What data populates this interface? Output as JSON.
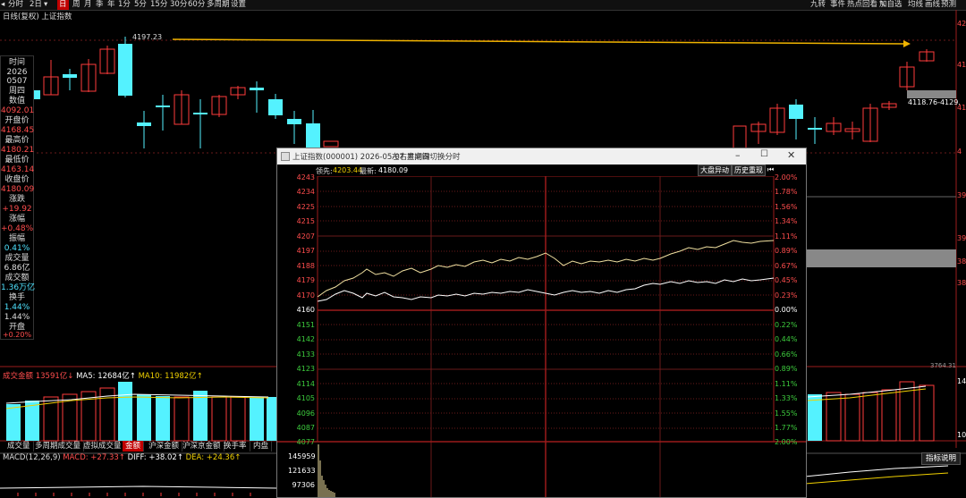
{
  "toolbar": {
    "left_items": [
      "分时",
      "2日",
      "日",
      "周",
      "月",
      "季",
      "年",
      "1分",
      "5分",
      "15分",
      "30分",
      "60分",
      "多周期",
      "设置"
    ],
    "active": "日",
    "right_items": [
      "九转",
      "事件",
      "热点回看",
      "自选",
      "均线",
      "画线",
      "预测"
    ]
  },
  "chart": {
    "subtitle": "日线(复权) 上证指数",
    "high_label": "4197.23",
    "last_range_label": "4118.76-4129.",
    "right_axis": [
      "42",
      "41",
      "41",
      "4",
      "39",
      "39",
      "38",
      "38",
      "3764.31",
      "14",
      "10"
    ]
  },
  "info_panel": [
    {
      "label": "时间",
      "value": "2026",
      "color": "lbl"
    },
    {
      "label": "",
      "value": "0507",
      "color": "lbl"
    },
    {
      "label": "",
      "value": "周四",
      "color": "lbl"
    },
    {
      "label": "数值",
      "value": "4092.01",
      "color": "red"
    },
    {
      "label": "开盘价",
      "value": "4168.45",
      "color": "red"
    },
    {
      "label": "最高价",
      "value": "4180.21",
      "color": "red"
    },
    {
      "label": "最低价",
      "value": "4163.14",
      "color": "red"
    },
    {
      "label": "收盘价",
      "value": "4180.09",
      "color": "red"
    },
    {
      "label": "涨跌",
      "value": "+19.92",
      "color": "red"
    },
    {
      "label": "涨幅",
      "value": "+0.48%",
      "color": "red"
    },
    {
      "label": "振幅",
      "value": "0.41%",
      "color": "cyan"
    },
    {
      "label": "成交量",
      "value": "6.86亿",
      "color": "lbl"
    },
    {
      "label": "成交额",
      "value": "1.36万亿",
      "color": "cyan"
    },
    {
      "label": "换手",
      "value": "1.44%",
      "color": "cyan"
    },
    {
      "label": "开盘涨幅",
      "value": "+0.20%",
      "color": "red"
    }
  ],
  "info_order": [
    "时间",
    "2026",
    "0507",
    "周四",
    "数值",
    "4092.01",
    "开盘价",
    "4168.45",
    "最高价",
    "4180.21",
    "最低价",
    "4163.14",
    "收盘价",
    "4180.09",
    "涨跌",
    "+19.92",
    "涨幅",
    "+0.48%",
    "振幅",
    "0.41%",
    "成交量",
    "6.86亿",
    "成交额",
    "1.36万亿",
    "换手",
    "1.44%",
    "开盘",
    "涨幅",
    "+0.20%"
  ],
  "volume_panel": {
    "label": "成交金额",
    "value": "13591亿",
    "ma5_label": "MA5:",
    "ma5": "12684亿",
    "ma10_label": "MA10:",
    "ma10": "11982亿"
  },
  "bottom_tabs": [
    "成交量",
    "多周期成交量",
    "虚拟成交量",
    "金额",
    "沪深金额",
    "沪深京金额",
    "换手率",
    "内盘"
  ],
  "bottom_tab_active": "金额",
  "macd": {
    "label": "MACD(12,26,9)",
    "macd": "MACD: +27.33",
    "diff": "DIFF: +38.02",
    "dea": "DEA: +24.36"
  },
  "indicator_help": "指标说明",
  "popup": {
    "title": "上证指数(000001) 2026-05-07 星期四",
    "hint": "左右方向键切换分时",
    "lead_label": "领先:",
    "lead_value": "4203.44",
    "latest_label": "最新:",
    "latest_value": "4180.09",
    "btn_market": "大盘异动",
    "btn_history": "历史重现",
    "left_axis": [
      "4243",
      "4234",
      "4225",
      "4215",
      "4207",
      "4197",
      "4188",
      "4179",
      "4170",
      "4160",
      "4151",
      "4142",
      "4133",
      "4123",
      "4114",
      "4105",
      "4096",
      "4087",
      "4077"
    ],
    "right_axis": [
      "2.00%",
      "1.78%",
      "1.56%",
      "1.34%",
      "1.11%",
      "0.89%",
      "0.67%",
      "0.45%",
      "0.23%",
      "0.00%",
      "0.22%",
      "0.44%",
      "0.66%",
      "0.89%",
      "1.11%",
      "1.33%",
      "1.55%",
      "1.77%",
      "2.00%"
    ],
    "vol_axis": [
      "145959",
      "121633",
      "97306"
    ]
  },
  "colors": {
    "up": "#ff3b3b",
    "down": "#54f2ff",
    "accent": "#c00000",
    "gold": "#f0b400"
  }
}
